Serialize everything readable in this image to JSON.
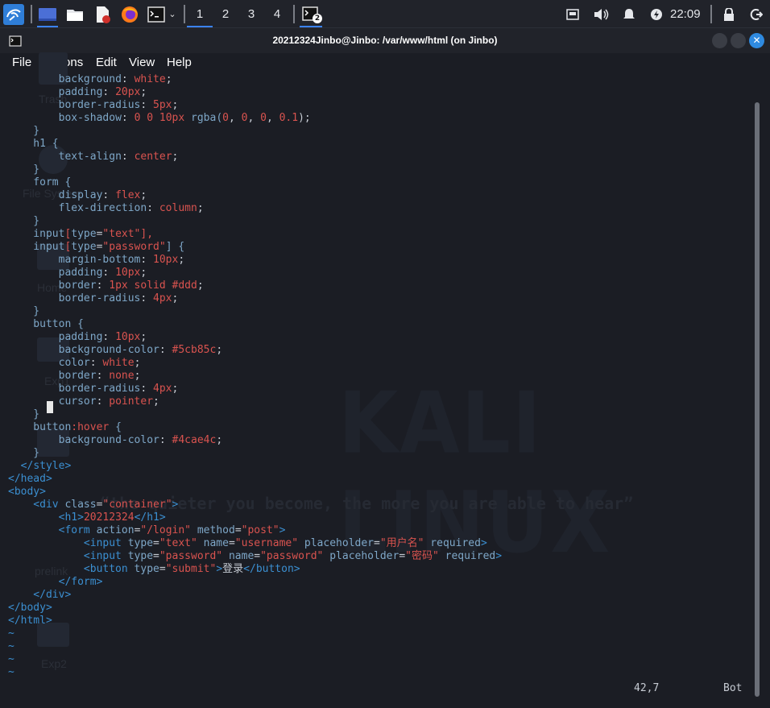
{
  "panel": {
    "workspaces": [
      "1",
      "2",
      "3",
      "4"
    ],
    "terminal_badge": "2",
    "clock": "22:09"
  },
  "window": {
    "title": "20212324Jinbo@Jinbo: /var/www/html (on Jinbo)",
    "menu": [
      "File",
      "Actions",
      "Edit",
      "View",
      "Help"
    ]
  },
  "desktop": {
    "icons": [
      "Trash",
      "File System",
      "Home",
      "Exp1",
      "prelink",
      "Exp2"
    ],
    "logo": "KALI LINUX",
    "tagline": "“the quieter you become, the more you are able to hear”"
  },
  "editor": {
    "status_position": "42,7",
    "status_scroll": "Bot",
    "lines": [
      [
        [
          "        ",
          "g"
        ],
        [
          "background",
          "k"
        ],
        [
          ": ",
          "g"
        ],
        [
          "white",
          "v"
        ],
        [
          ";",
          "g"
        ]
      ],
      [
        [
          "        ",
          "g"
        ],
        [
          "padding",
          "k"
        ],
        [
          ": ",
          "g"
        ],
        [
          "20px",
          "v"
        ],
        [
          ";",
          "g"
        ]
      ],
      [
        [
          "        ",
          "g"
        ],
        [
          "border-radius",
          "k"
        ],
        [
          ": ",
          "g"
        ],
        [
          "5px",
          "v"
        ],
        [
          ";",
          "g"
        ]
      ],
      [
        [
          "        ",
          "g"
        ],
        [
          "box-shadow",
          "k"
        ],
        [
          ": ",
          "g"
        ],
        [
          "0 0 10px ",
          "v"
        ],
        [
          "rgba(",
          "k"
        ],
        [
          "0",
          "v"
        ],
        [
          ", ",
          "g"
        ],
        [
          "0",
          "v"
        ],
        [
          ", ",
          "g"
        ],
        [
          "0",
          "v"
        ],
        [
          ", ",
          "g"
        ],
        [
          "0.1",
          "v"
        ],
        [
          ");",
          "g"
        ]
      ],
      [
        [
          "    }",
          "k"
        ]
      ],
      [
        [
          "    h1 {",
          "k"
        ]
      ],
      [
        [
          "        ",
          "g"
        ],
        [
          "text-align",
          "k"
        ],
        [
          ": ",
          "g"
        ],
        [
          "center",
          "v"
        ],
        [
          ";",
          "g"
        ]
      ],
      [
        [
          "    }",
          "k"
        ]
      ],
      [
        [
          "    form {",
          "k"
        ]
      ],
      [
        [
          "        ",
          "g"
        ],
        [
          "display",
          "k"
        ],
        [
          ": ",
          "g"
        ],
        [
          "flex",
          "v"
        ],
        [
          ";",
          "g"
        ]
      ],
      [
        [
          "        ",
          "g"
        ],
        [
          "flex-direction",
          "k"
        ],
        [
          ": ",
          "g"
        ],
        [
          "column",
          "v"
        ],
        [
          ";",
          "g"
        ]
      ],
      [
        [
          "    }",
          "k"
        ]
      ],
      [
        [
          "    input",
          "k"
        ],
        [
          "[",
          "v"
        ],
        [
          "type",
          "k"
        ],
        [
          "=",
          "g"
        ],
        [
          "\"text\"",
          "s"
        ],
        [
          "],",
          "v"
        ]
      ],
      [
        [
          "    input",
          "k"
        ],
        [
          "[",
          "v"
        ],
        [
          "type",
          "k"
        ],
        [
          "=",
          "g"
        ],
        [
          "\"password\"",
          "s"
        ],
        [
          "] {",
          "k"
        ]
      ],
      [
        [
          "        ",
          "g"
        ],
        [
          "margin-bottom",
          "k"
        ],
        [
          ": ",
          "g"
        ],
        [
          "10px",
          "v"
        ],
        [
          ";",
          "g"
        ]
      ],
      [
        [
          "        ",
          "g"
        ],
        [
          "padding",
          "k"
        ],
        [
          ": ",
          "g"
        ],
        [
          "10px",
          "v"
        ],
        [
          ";",
          "g"
        ]
      ],
      [
        [
          "        ",
          "g"
        ],
        [
          "border",
          "k"
        ],
        [
          ": ",
          "g"
        ],
        [
          "1px solid #ddd",
          "v"
        ],
        [
          ";",
          "g"
        ]
      ],
      [
        [
          "        ",
          "g"
        ],
        [
          "border-radius",
          "k"
        ],
        [
          ": ",
          "g"
        ],
        [
          "4px",
          "v"
        ],
        [
          ";",
          "g"
        ]
      ],
      [
        [
          "    }",
          "k"
        ]
      ],
      [
        [
          "    button {",
          "k"
        ]
      ],
      [
        [
          "        ",
          "g"
        ],
        [
          "padding",
          "k"
        ],
        [
          ": ",
          "g"
        ],
        [
          "10px",
          "v"
        ],
        [
          ";",
          "g"
        ]
      ],
      [
        [
          "        ",
          "g"
        ],
        [
          "background-color",
          "k"
        ],
        [
          ": ",
          "g"
        ],
        [
          "#5cb85c",
          "v"
        ],
        [
          ";",
          "g"
        ]
      ],
      [
        [
          "        ",
          "g"
        ],
        [
          "color",
          "k"
        ],
        [
          ": ",
          "g"
        ],
        [
          "white",
          "v"
        ],
        [
          ";",
          "g"
        ]
      ],
      [
        [
          "        ",
          "g"
        ],
        [
          "border",
          "k"
        ],
        [
          ": ",
          "g"
        ],
        [
          "none",
          "v"
        ],
        [
          ";",
          "g"
        ]
      ],
      [
        [
          "        ",
          "g"
        ],
        [
          "border-radius",
          "k"
        ],
        [
          ": ",
          "g"
        ],
        [
          "4px",
          "v"
        ],
        [
          ";",
          "g"
        ]
      ],
      [
        [
          "        ",
          "g"
        ],
        [
          "cursor",
          "k"
        ],
        [
          ": ",
          "g"
        ],
        [
          "pointer",
          "v"
        ],
        [
          ";",
          "g"
        ]
      ],
      [
        [
          "    }",
          "k"
        ]
      ],
      [
        [
          "    button",
          "k"
        ],
        [
          ":hover",
          "v"
        ],
        [
          " {",
          "k"
        ]
      ],
      [
        [
          "        ",
          "g"
        ],
        [
          "background-color",
          "k"
        ],
        [
          ": ",
          "g"
        ],
        [
          "#4cae4c",
          "v"
        ],
        [
          ";",
          "g"
        ]
      ],
      [
        [
          "    }",
          "k"
        ]
      ],
      [
        [
          "  </",
          "t"
        ],
        [
          "style",
          "t"
        ],
        [
          ">",
          "t"
        ]
      ],
      [
        [
          "</",
          "t"
        ],
        [
          "head",
          "t"
        ],
        [
          ">",
          "t"
        ]
      ],
      [
        [
          "<",
          "t"
        ],
        [
          "body",
          "t"
        ],
        [
          ">",
          "t"
        ]
      ],
      [
        [
          "    <",
          "t"
        ],
        [
          "div ",
          "t"
        ],
        [
          "class",
          "k"
        ],
        [
          "=",
          "g"
        ],
        [
          "\"container\"",
          "s"
        ],
        [
          ">",
          "t"
        ]
      ],
      [
        [
          "        <",
          "t"
        ],
        [
          "h1",
          "t"
        ],
        [
          ">",
          "t"
        ],
        [
          "20212324",
          "v"
        ],
        [
          "</",
          "t"
        ],
        [
          "h1",
          "t"
        ],
        [
          ">",
          "t"
        ]
      ],
      [
        [
          "        <",
          "t"
        ],
        [
          "form ",
          "t"
        ],
        [
          "action",
          "k"
        ],
        [
          "=",
          "g"
        ],
        [
          "\"/login\"",
          "s"
        ],
        [
          " method",
          "k"
        ],
        [
          "=",
          "g"
        ],
        [
          "\"post\"",
          "s"
        ],
        [
          ">",
          "t"
        ]
      ],
      [
        [
          "            <",
          "t"
        ],
        [
          "input ",
          "t"
        ],
        [
          "type",
          "k"
        ],
        [
          "=",
          "g"
        ],
        [
          "\"text\"",
          "s"
        ],
        [
          " name",
          "k"
        ],
        [
          "=",
          "g"
        ],
        [
          "\"username\"",
          "s"
        ],
        [
          " placeholder",
          "k"
        ],
        [
          "=",
          "g"
        ],
        [
          "\"用户名\"",
          "s"
        ],
        [
          " required",
          "k"
        ],
        [
          ">",
          "t"
        ]
      ],
      [
        [
          "            <",
          "t"
        ],
        [
          "input ",
          "t"
        ],
        [
          "type",
          "k"
        ],
        [
          "=",
          "g"
        ],
        [
          "\"password\"",
          "s"
        ],
        [
          " name",
          "k"
        ],
        [
          "=",
          "g"
        ],
        [
          "\"password\"",
          "s"
        ],
        [
          " placeholder",
          "k"
        ],
        [
          "=",
          "g"
        ],
        [
          "\"密码\"",
          "s"
        ],
        [
          " required",
          "k"
        ],
        [
          ">",
          "t"
        ]
      ],
      [
        [
          "            <",
          "t"
        ],
        [
          "button ",
          "t"
        ],
        [
          "type",
          "k"
        ],
        [
          "=",
          "g"
        ],
        [
          "\"submit\"",
          "s"
        ],
        [
          ">",
          "t"
        ],
        [
          "登录",
          "g"
        ],
        [
          "</",
          "t"
        ],
        [
          "button",
          "t"
        ],
        [
          ">",
          "t"
        ]
      ],
      [
        [
          "        </",
          "t"
        ],
        [
          "form",
          "t"
        ],
        [
          ">",
          "t"
        ]
      ],
      [
        [
          "    </",
          "t"
        ],
        [
          "div",
          "t"
        ],
        [
          ">",
          "t"
        ]
      ],
      [
        [
          "</",
          "t"
        ],
        [
          "body",
          "t"
        ],
        [
          ">",
          "t"
        ]
      ],
      [
        [
          "</",
          "t"
        ],
        [
          "html",
          "t"
        ],
        [
          ">",
          "t"
        ]
      ],
      [
        [
          "~",
          "tilde"
        ]
      ],
      [
        [
          "~",
          "tilde"
        ]
      ],
      [
        [
          "~",
          "tilde"
        ]
      ],
      [
        [
          "~",
          "tilde"
        ]
      ]
    ]
  }
}
